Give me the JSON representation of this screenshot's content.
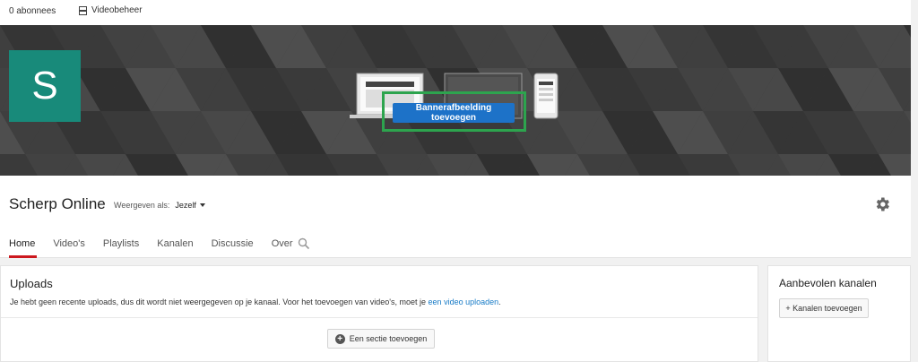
{
  "topbar": {
    "subscribers": "0 abonnees",
    "video_manager": "Videobeheer"
  },
  "banner": {
    "avatar_letter": "S",
    "add_banner_label": "Bannerafbeelding toevoegen",
    "colors": {
      "background": "#3d3d3d",
      "highlight": "#2da44e",
      "button": "#1d72c8",
      "avatar": "#188a7a"
    }
  },
  "channel": {
    "title": "Scherp Online",
    "view_as_label": "Weergeven als:",
    "view_as_value": "Jezelf"
  },
  "tabs": [
    {
      "label": "Home",
      "active": true
    },
    {
      "label": "Video's",
      "active": false
    },
    {
      "label": "Playlists",
      "active": false
    },
    {
      "label": "Kanalen",
      "active": false
    },
    {
      "label": "Discussie",
      "active": false
    },
    {
      "label": "Over",
      "active": false
    }
  ],
  "uploads": {
    "title": "Uploads",
    "message": "Je hebt geen recente uploads, dus dit wordt niet weergegeven op je kanaal. Voor het toevoegen van video's, moet je ",
    "link_text": "een video uploaden",
    "message_end": ".",
    "add_section_label": "Een sectie toevoegen"
  },
  "recommended": {
    "title": "Aanbevolen kanalen",
    "add_label": "+ Kanalen toevoegen"
  },
  "icons": [
    "video-manager-icon",
    "gear-icon",
    "search-icon",
    "plus-circle-icon",
    "chevron-down-icon"
  ]
}
